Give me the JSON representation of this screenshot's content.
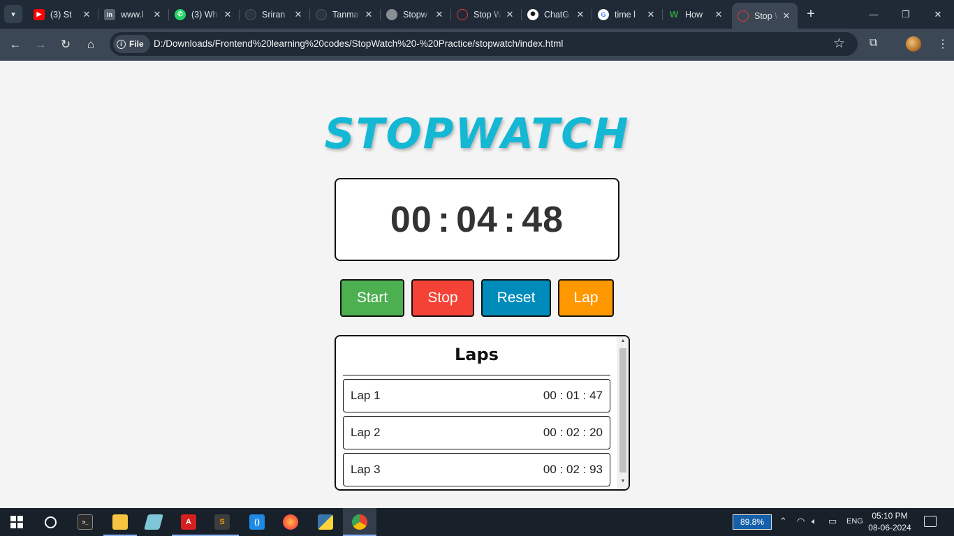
{
  "browser": {
    "tabs": [
      {
        "title": "(3) St",
        "icon": "youtube-icon",
        "color": "#ff0000"
      },
      {
        "title": "www.l",
        "icon": "linkedin-icon",
        "color": "#0a66c2"
      },
      {
        "title": "(3) Wh",
        "icon": "whatsapp-icon",
        "color": "#25d366"
      },
      {
        "title": "Sriran",
        "icon": "github-icon",
        "color": "#333333"
      },
      {
        "title": "Tanma",
        "icon": "github-icon",
        "color": "#333333"
      },
      {
        "title": "Stopw",
        "icon": "globe-icon",
        "color": "#8a8f95"
      },
      {
        "title": "Stop W",
        "icon": "stopwatch-icon",
        "color": "#e53935"
      },
      {
        "title": "ChatG",
        "icon": "chatgpt-icon",
        "color": "#ffffff"
      },
      {
        "title": "time l",
        "icon": "google-icon",
        "color": "#ffffff"
      },
      {
        "title": "How",
        "icon": "w-logo-icon",
        "color": "#1a7f37"
      },
      {
        "title": "Stop W",
        "icon": "stopwatch-icon",
        "color": "#e53935",
        "active": true
      }
    ],
    "address_chip": "File",
    "url": "D:/Downloads/Frontend%20learning%20codes/StopWatch%20-%20Practice/stopwatch/index.html"
  },
  "app": {
    "title": "STOPWATCH",
    "time": {
      "hours": "00",
      "minutes": "04",
      "seconds": "48",
      "separator": ":"
    },
    "buttons": {
      "start": {
        "label": "Start",
        "color": "#4caf50"
      },
      "stop": {
        "label": "Stop",
        "color": "#f44336"
      },
      "reset": {
        "label": "Reset",
        "color": "#008cba"
      },
      "lap": {
        "label": "Lap",
        "color": "#ff9800"
      }
    },
    "laps_title": "Laps",
    "laps": [
      {
        "label": "Lap 1",
        "time": "00 : 01 : 47"
      },
      {
        "label": "Lap 2",
        "time": "00 : 02 : 20"
      },
      {
        "label": "Lap 3",
        "time": "00 : 02 : 93"
      }
    ]
  },
  "taskbar": {
    "apps": [
      "start-menu-icon",
      "search-icon",
      "terminal-icon",
      "file-explorer-icon",
      "pen-app-icon",
      "acrobat-icon",
      "sublime-text-icon",
      "vscode-icon",
      "firefox-icon",
      "python-icon",
      "chrome-icon"
    ],
    "battery": "89.8%",
    "language": "ENG",
    "time": "05:10 PM",
    "date": "08-06-2024"
  }
}
